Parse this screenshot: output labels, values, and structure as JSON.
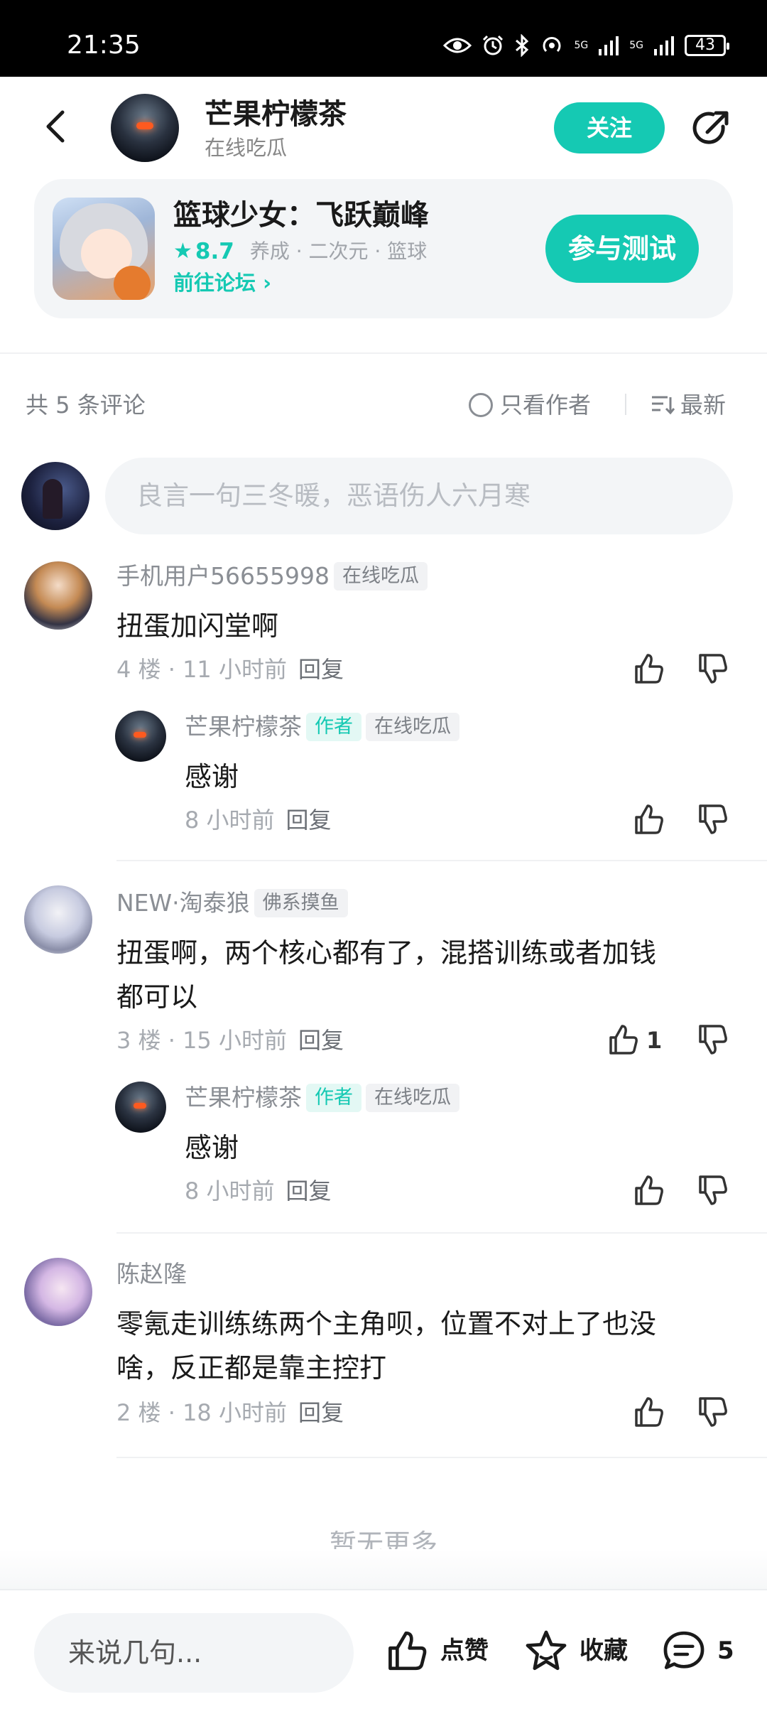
{
  "status_bar": {
    "time": "21:35",
    "battery": "43"
  },
  "header": {
    "name": "芒果柠檬茶",
    "subtitle": "在线吃瓜",
    "follow_label": "关注"
  },
  "game": {
    "title": "篮球少女：飞跃巅峰",
    "rating": "8.7",
    "tags": "养成 · 二次元 · 篮球",
    "forum_link": "前往论坛",
    "join_label": "参与测试"
  },
  "comments_bar": {
    "count_text": "共 5 条评论",
    "author_only": "只看作者",
    "sort": "最新"
  },
  "compose": {
    "placeholder": "良言一句三冬暖，恶语伤人六月寒"
  },
  "comments": [
    {
      "user": "手机用户56655998",
      "tag": "在线吃瓜",
      "text": "扭蛋加闪堂啊",
      "floor": "4 楼",
      "time": "11 小时前",
      "reply_label": "回复",
      "likes": "",
      "reply": {
        "user": "芒果柠檬茶",
        "author_tag": "作者",
        "tag": "在线吃瓜",
        "text": "感谢",
        "time": "8 小时前",
        "reply_label": "回复"
      }
    },
    {
      "user": "NEW·淘泰狼",
      "tag": "佛系摸鱼",
      "text_line1": "扭蛋啊，两个核心都有了，混搭训练或者加钱",
      "text_line2": "都可以",
      "floor": "3 楼",
      "time": "15 小时前",
      "reply_label": "回复",
      "likes": "1",
      "reply": {
        "user": "芒果柠檬茶",
        "author_tag": "作者",
        "tag": "在线吃瓜",
        "text": "感谢",
        "time": "8 小时前",
        "reply_label": "回复"
      }
    },
    {
      "user": "陈赵隆",
      "text_line1": "零氪走训练练两个主角呗，位置不对上了也没",
      "text_line2": "啥，反正都是靠主控打",
      "floor": "2 楼",
      "time": "18 小时前",
      "reply_label": "回复",
      "likes": ""
    }
  ],
  "no_more": "暂无更多",
  "bottom_bar": {
    "input_placeholder": "来说几句...",
    "like_label": "点赞",
    "favorite_label": "收藏",
    "comment_count": "5"
  },
  "colors": {
    "accent": "#15c9b3",
    "muted": "#8a8e94"
  }
}
